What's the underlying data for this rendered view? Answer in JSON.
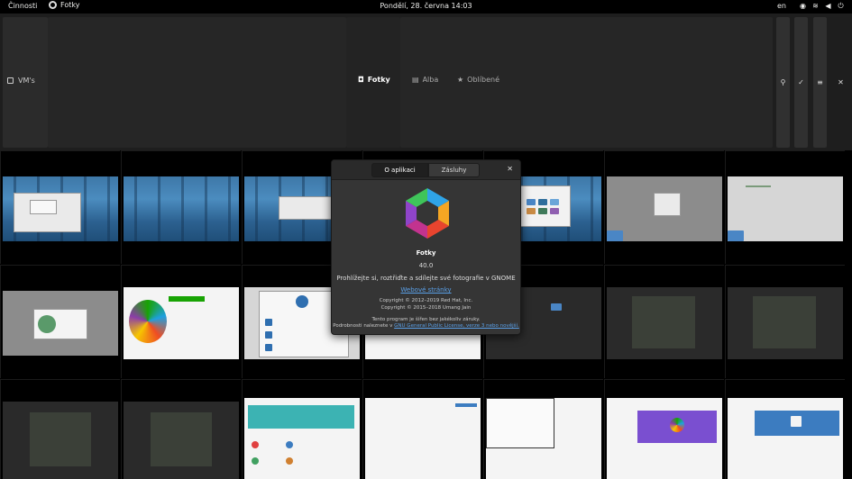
{
  "topbar": {
    "activities": "Činnosti",
    "app_name": "Fotky",
    "clock": "Pondělí, 28. června  14:03",
    "language": "en",
    "tray_icons": [
      "accessibility-icon",
      "wifi-icon",
      "volume-icon",
      "power-icon"
    ]
  },
  "header": {
    "collection_label": "VM's",
    "views": [
      {
        "label": "Fotky",
        "icon": "camera-icon",
        "active": true
      },
      {
        "label": "Alba",
        "icon": "albums-icon",
        "active": false
      },
      {
        "label": "Oblíbené",
        "icon": "star-icon",
        "active": false
      }
    ],
    "buttons": [
      "search-icon",
      "check-icon",
      "menu-icon",
      "close-icon"
    ]
  },
  "dialog": {
    "tabs": [
      {
        "label": "O aplikaci",
        "active": true
      },
      {
        "label": "Zásluhy",
        "active": false
      }
    ],
    "app_name": "Fotky",
    "version": "40.0",
    "description": "Prohlížejte si, roztřiďte a sdílejte své fotografie v GNOME",
    "website": "Webové stránky",
    "copyright_1": "Copyright © 2012–2019 Red Hat, Inc.",
    "copyright_2": "Copyright © 2015–2018 Umang Jain",
    "license_1": "Tento program je šířen bez jakékoliv záruky.",
    "license_2_prefix": "Podrobnosti naleznete v ",
    "license_2_link": "GNU General Public License, verze 3 nebo novější."
  },
  "colors": {
    "topbar": "#000000",
    "headerbar": "#1e1e1e",
    "dialog_bg": "#353535",
    "link": "#5aa0e8"
  }
}
